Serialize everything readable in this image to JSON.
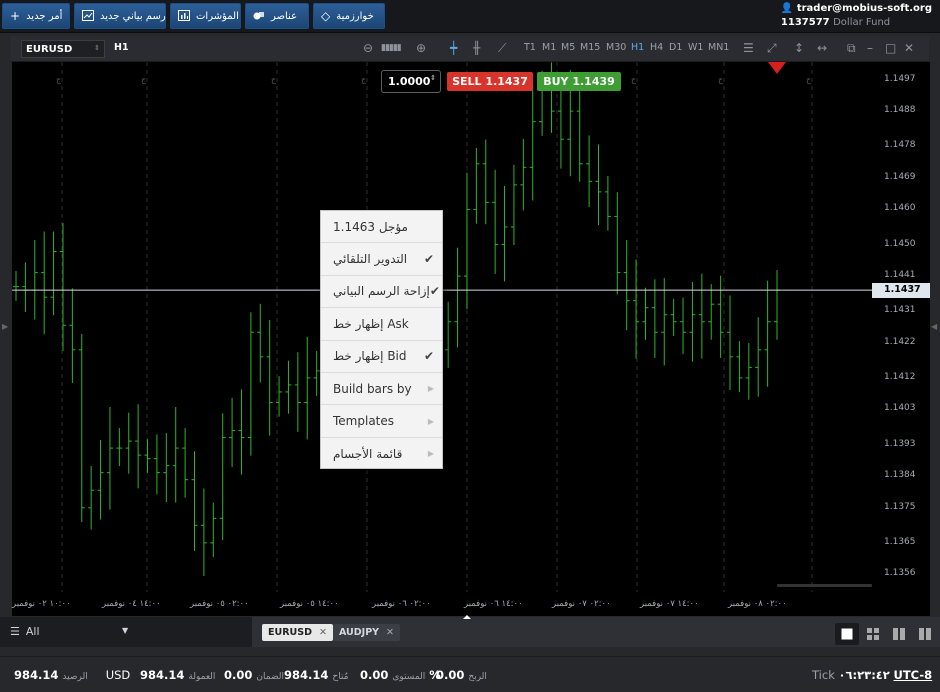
{
  "toolbar": {
    "buttons": [
      {
        "label": "أمر جديد",
        "icon": "plus-icon"
      },
      {
        "label": "رسم بياني جديد",
        "icon": "line-chart-icon"
      },
      {
        "label": "المؤشرات",
        "icon": "bar-chart-icon"
      },
      {
        "label": "عناصر",
        "icon": "shapes-icon"
      },
      {
        "label": "خوارزمية",
        "icon": "diamond-icon"
      }
    ]
  },
  "account": {
    "user": "trader@mobius-soft.org",
    "number": "1137577",
    "fund": "Dollar Fund"
  },
  "chart_toolbar": {
    "symbol": "EURUSD",
    "period": "H1",
    "timeframes": [
      "T1",
      "M1",
      "M5",
      "M15",
      "M30",
      "H1",
      "H4",
      "D1",
      "W1",
      "MN1"
    ],
    "active_timeframe": "H1"
  },
  "trade_panel": {
    "quantity": "1.0000",
    "sell_label": "SELL",
    "sell_price": "1.1437",
    "buy_label": "BUY",
    "buy_price": "1.1439"
  },
  "context_menu": {
    "items": [
      {
        "label": "مؤجل 1.1463",
        "checked": false,
        "submenu": false
      },
      {
        "label": "التدوير التلقائي",
        "checked": true,
        "submenu": false
      },
      {
        "label": "إزاحة الرسم البياني",
        "checked": true,
        "submenu": false
      },
      {
        "label": "إظهار خط Ask",
        "checked": false,
        "submenu": false
      },
      {
        "label": "إظهار خط Bid",
        "checked": true,
        "submenu": false
      },
      {
        "label": "Build bars by",
        "checked": false,
        "submenu": true
      },
      {
        "label": "Templates",
        "checked": false,
        "submenu": true
      },
      {
        "label": "قائمة الأجسام",
        "checked": false,
        "submenu": true
      }
    ]
  },
  "chart_data": {
    "type": "ohlc",
    "symbol": "EURUSD",
    "timeframe": "H1",
    "y_ticks": [
      1.1497,
      1.1488,
      1.1478,
      1.1469,
      1.146,
      1.145,
      1.1441,
      1.1431,
      1.1422,
      1.1412,
      1.1403,
      1.1393,
      1.1384,
      1.1375,
      1.1365,
      1.1356
    ],
    "ylim": [
      1.1351,
      1.1502
    ],
    "current_bid": "1.1437",
    "x_labels": [
      "١٠:٠٠ ٠٢ نوفمبر",
      "١٤:٠٠ ٠٤ نوفمبر",
      "٠٢:٠٠ ٠٥ نوفمبر",
      "١٤:٠٠ ٠٥ نوفمبر",
      "٠٢:٠٠ ٠٦ نوفمبر",
      "١٤:٠٠ ٠٦ نوفمبر",
      "٠٢:٠٠ ٠٧ نوفمبر",
      "١٤:٠٠ ٠٧ نوفمبر",
      "٠٢:٠٠ ٠٨ نوفمبر"
    ],
    "day_markers": [
      "ج",
      "ج",
      "ج",
      "ج",
      "ج",
      "ج",
      "ج",
      "ج",
      "ج"
    ],
    "close_approx": [
      1.1438,
      1.1437,
      1.1442,
      1.1435,
      1.1448,
      1.1427,
      1.142,
      1.1375,
      1.138,
      1.1385,
      1.1392,
      1.1392,
      1.1394,
      1.139,
      1.1389,
      1.1385,
      1.1387,
      1.1392,
      1.1383,
      1.137,
      1.1365,
      1.1372,
      1.1395,
      1.1397,
      1.1395,
      1.1425,
      1.1418,
      1.1405,
      1.1408,
      1.141,
      1.1405,
      1.1412,
      1.1414,
      1.1412,
      1.1415,
      1.1407,
      1.1395,
      1.1413,
      1.1411,
      1.142,
      1.1435,
      1.1415,
      1.1405,
      1.1414,
      1.1418,
      1.142,
      1.1428,
      1.1441,
      1.146,
      1.1473,
      1.1462,
      1.145,
      1.1455,
      1.1467,
      1.1472,
      1.1485,
      1.1495,
      1.1488,
      1.148,
      1.1488,
      1.1473,
      1.1468,
      1.1465,
      1.1458,
      1.1442,
      1.1434,
      1.1428,
      1.1432,
      1.1425,
      1.143,
      1.1428,
      1.1425,
      1.143,
      1.1428,
      1.1433,
      1.1425,
      1.1418,
      1.1412,
      1.1415,
      1.142,
      1.1428,
      1.1437
    ]
  },
  "tabs": {
    "filter_label": "All",
    "items": [
      "EURUSD",
      "AUDJPY"
    ],
    "active": "EURUSD"
  },
  "status": {
    "balance_label": "الرصيد",
    "balance": "984.14",
    "currency": "USD",
    "equity_label": "العمولة",
    "equity": "984.14",
    "margin_label": "الضمان",
    "margin": "0.00",
    "free_label": "مُتاح",
    "free": "984.14",
    "level_label": "المستوى",
    "level": "0.00",
    "level_unit": "%",
    "profit_label": "الربح",
    "profit": "0.00",
    "tick_label": "Tick",
    "time": "٠٦:٢٣:٤٢",
    "timezone": "UTC-8"
  }
}
